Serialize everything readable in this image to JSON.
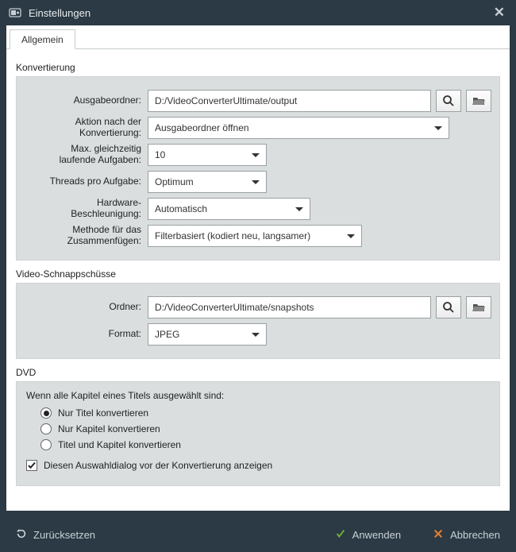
{
  "window": {
    "title": "Einstellungen"
  },
  "tabs": {
    "general": "Allgemein"
  },
  "conversion": {
    "title": "Konvertierung",
    "output_folder_label": "Ausgabeordner:",
    "output_folder_value": "D:/VideoConverterUltimate/output",
    "post_action_label": "Aktion nach der\nKonvertierung:",
    "post_action_value": "Ausgabeordner öffnen",
    "max_tasks_label": "Max. gleichzeitig\nlaufende Aufgaben:",
    "max_tasks_value": "10",
    "threads_label": "Threads pro Aufgabe:",
    "threads_value": "Optimum",
    "hwaccel_label": "Hardware-\nBeschleunigung:",
    "hwaccel_value": "Automatisch",
    "merge_label": "Methode für das\nZusammenfügen:",
    "merge_value": "Filterbasiert (kodiert neu, langsamer)"
  },
  "snapshots": {
    "title": "Video-Schnappschüsse",
    "folder_label": "Ordner:",
    "folder_value": "D:/VideoConverterUltimate/snapshots",
    "format_label": "Format:",
    "format_value": "JPEG"
  },
  "dvd": {
    "title": "DVD",
    "question": "Wenn alle Kapitel eines Titels ausgewählt sind:",
    "opt_title_only": "Nur Titel konvertieren",
    "opt_chapters_only": "Nur Kapitel konvertieren",
    "opt_both": "Titel und Kapitel konvertieren",
    "selected_option": 0,
    "show_dialog_label": "Diesen Auswahldialog vor der Konvertierung anzeigen",
    "show_dialog_checked": true
  },
  "footer": {
    "reset": "Zurücksetzen",
    "apply": "Anwenden",
    "cancel": "Abbrechen"
  }
}
